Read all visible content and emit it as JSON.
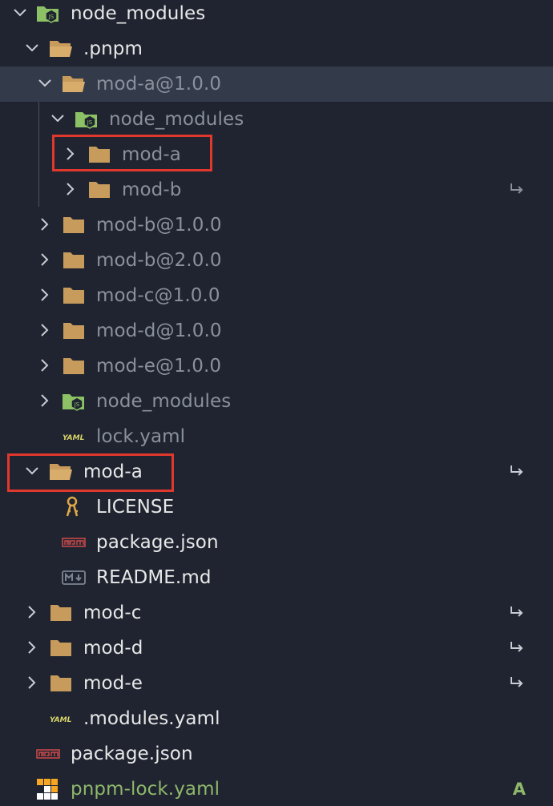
{
  "explorer": {
    "items": [
      {
        "label": "node_modules",
        "icon": "nodejs-folder-icon",
        "expanded": true
      },
      {
        "label": ".pnpm",
        "icon": "folder-open-icon",
        "expanded": true
      },
      {
        "label": "mod-a@1.0.0",
        "icon": "folder-open-icon",
        "expanded": true,
        "selected": true
      },
      {
        "label": "node_modules",
        "icon": "nodejs-folder-icon",
        "expanded": true
      },
      {
        "label": "mod-a",
        "icon": "folder-icon",
        "expanded": false,
        "highlighted": true
      },
      {
        "label": "mod-b",
        "icon": "folder-icon",
        "expanded": false,
        "symlink": true
      },
      {
        "label": "mod-b@1.0.0",
        "icon": "folder-icon",
        "expanded": false
      },
      {
        "label": "mod-b@2.0.0",
        "icon": "folder-icon",
        "expanded": false
      },
      {
        "label": "mod-c@1.0.0",
        "icon": "folder-icon",
        "expanded": false
      },
      {
        "label": "mod-d@1.0.0",
        "icon": "folder-icon",
        "expanded": false
      },
      {
        "label": "mod-e@1.0.0",
        "icon": "folder-icon",
        "expanded": false
      },
      {
        "label": "node_modules",
        "icon": "nodejs-folder-icon",
        "expanded": false
      },
      {
        "label": "lock.yaml",
        "icon": "yaml-file-icon"
      },
      {
        "label": "mod-a",
        "icon": "folder-open-icon",
        "expanded": true,
        "symlink": true,
        "highlighted": true
      },
      {
        "label": "LICENSE",
        "icon": "license-key-icon"
      },
      {
        "label": "package.json",
        "icon": "npm-file-icon"
      },
      {
        "label": "README.md",
        "icon": "markdown-file-icon"
      },
      {
        "label": "mod-c",
        "icon": "folder-icon",
        "expanded": false,
        "symlink": true
      },
      {
        "label": "mod-d",
        "icon": "folder-icon",
        "expanded": false,
        "symlink": true
      },
      {
        "label": "mod-e",
        "icon": "folder-icon",
        "expanded": false,
        "symlink": true
      },
      {
        "label": ".modules.yaml",
        "icon": "yaml-file-icon"
      },
      {
        "label": "package.json",
        "icon": "npm-file-icon"
      },
      {
        "label": "pnpm-lock.yaml",
        "icon": "pnpm-file-icon",
        "git_status": "A"
      }
    ]
  },
  "colors": {
    "background": "#1f2430",
    "selected_row": "#333a4a",
    "highlight_box": "#e0382d",
    "folder": "#c79b5b",
    "git_added": "#8fb86b"
  }
}
